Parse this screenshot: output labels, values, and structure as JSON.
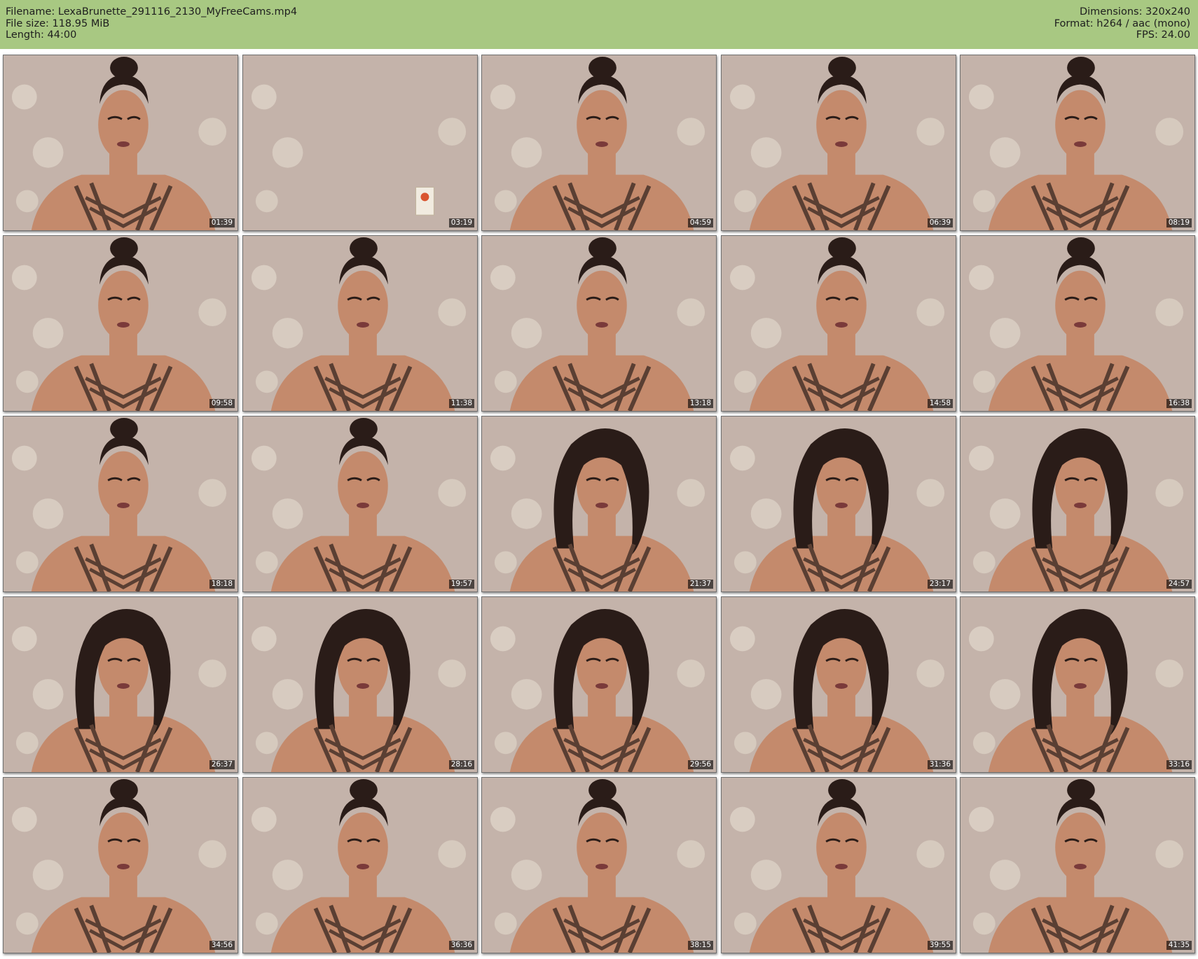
{
  "file_info": {
    "filename_line": "Filename: LexaBrunette_291116_2130_MyFreeCams.mp4",
    "size_line": "File size: 118.95 MiB",
    "length_line": "Length: 44:00",
    "dimensions_line": "Dimensions: 320x240",
    "format_line": "Format: h264 / aac (mono)",
    "fps_line": "FPS: 24.00"
  },
  "colors": {
    "header_bg": "#a8c882",
    "wall": "#c4b3aa",
    "flower": "#e2d8cc",
    "skin": "#c48a6c",
    "hair": "#2a1c18",
    "strap": "#5a3f33",
    "timestamp_bg": "#000000"
  },
  "thumbnails": [
    {
      "time": "01:39",
      "hair": "bun"
    },
    {
      "time": "03:19",
      "hair": "none"
    },
    {
      "time": "04:59",
      "hair": "bun"
    },
    {
      "time": "06:39",
      "hair": "bun"
    },
    {
      "time": "08:19",
      "hair": "bun"
    },
    {
      "time": "09:58",
      "hair": "bun"
    },
    {
      "time": "11:38",
      "hair": "bun"
    },
    {
      "time": "13:18",
      "hair": "bun"
    },
    {
      "time": "14:58",
      "hair": "bun"
    },
    {
      "time": "16:38",
      "hair": "bun"
    },
    {
      "time": "18:18",
      "hair": "bun"
    },
    {
      "time": "19:57",
      "hair": "bun"
    },
    {
      "time": "21:37",
      "hair": "loose"
    },
    {
      "time": "23:17",
      "hair": "loose"
    },
    {
      "time": "24:57",
      "hair": "loose"
    },
    {
      "time": "26:37",
      "hair": "loose"
    },
    {
      "time": "28:16",
      "hair": "loose"
    },
    {
      "time": "29:56",
      "hair": "loose"
    },
    {
      "time": "31:36",
      "hair": "loose"
    },
    {
      "time": "33:16",
      "hair": "loose"
    },
    {
      "time": "34:56",
      "hair": "bun"
    },
    {
      "time": "36:36",
      "hair": "bun"
    },
    {
      "time": "38:15",
      "hair": "bun"
    },
    {
      "time": "39:55",
      "hair": "bun"
    },
    {
      "time": "41:35",
      "hair": "bun"
    }
  ]
}
